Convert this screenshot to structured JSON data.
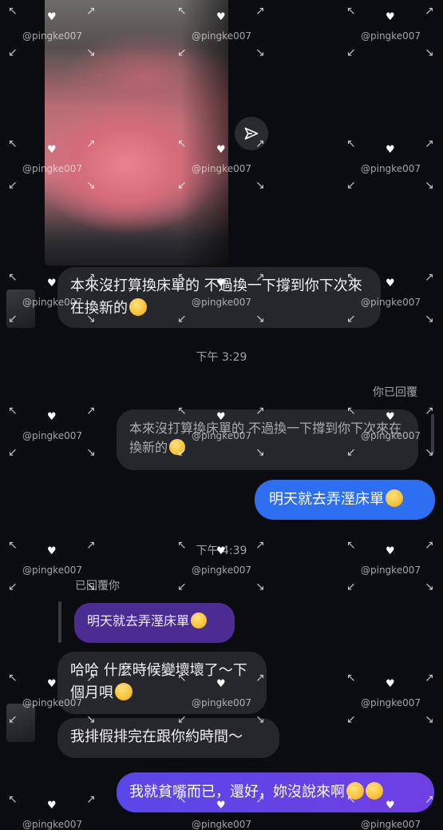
{
  "messages": {
    "photo_caption": "本來沒打算換床單的 不過換一下撐到你下次來在換新的",
    "time_1": "下午 3:29",
    "you_replied": "你已回覆",
    "quoted_text": "本來沒打算換床單的 不過換一下撐到你下次來在換新的",
    "sent_1": "明天就去弄溼床單",
    "time_2": "下午 4:39",
    "replied_to_you": "已回覆你",
    "quoted_purple": "明天就去弄溼床單",
    "recv_1": "哈哈 什麼時候變壞壞了～下個月唄",
    "recv_2": "我排假排完在跟你約時間～",
    "sent_2": "我就貧嘴而已，還好，妳沒說來啊"
  },
  "icons": {
    "share": "send-arrow-icon",
    "emoji_shy": "shushing-face-emoji",
    "emoji_laugh": "rolling-laughing-emoji"
  },
  "watermark": {
    "text": "@pingke007",
    "heart": "♥"
  },
  "colors": {
    "background": "#0b0c10",
    "incoming": "#26272c",
    "outgoing": "#2d6ff0",
    "quoted_purple": "#4a2c93",
    "outgoing_gradient_start": "#5a47e8"
  }
}
